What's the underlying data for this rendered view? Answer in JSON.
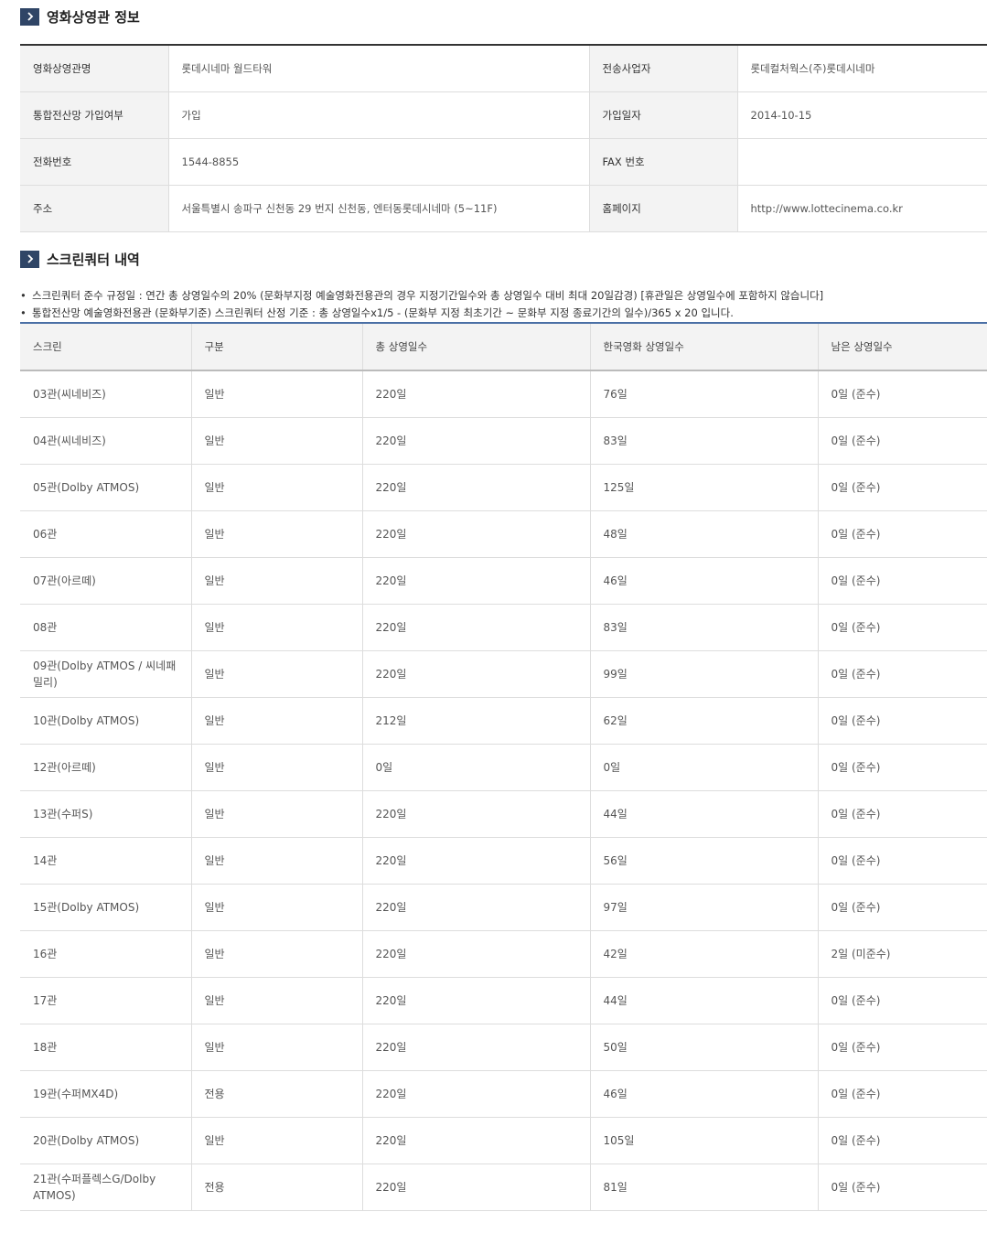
{
  "theater_section": {
    "title": "영화상영관 정보",
    "rows": [
      {
        "label1": "영화상영관명",
        "value1": "롯데시네마 월드타워",
        "label2": "전송사업자",
        "value2": "롯데컬처웍스(주)롯데시네마"
      },
      {
        "label1": "통합전산망 가입여부",
        "value1": "가입",
        "label2": "가입일자",
        "value2": "2014-10-15"
      },
      {
        "label1": "전화번호",
        "value1": "1544-8855",
        "label2": "FAX 번호",
        "value2": ""
      },
      {
        "label1": "주소",
        "value1": "서울특별시 송파구 신천동 29 번지 신천동, 엔터동롯데시네마 (5~11F)",
        "label2": "홈페이지",
        "value2": "http://www.lottecinema.co.kr"
      }
    ]
  },
  "quota_section": {
    "title": "스크린쿼터 내역",
    "notes": [
      "스크린쿼터 준수 규정일 : 연간 총 상영일수의 20% (문화부지정 예술영화전용관의 경우 지정기간일수와 총 상영일수 대비 최대 20일감경) [휴관일은 상영일수에 포함하지 않습니다]",
      "통합전산망 예술영화전용관 (문화부기준) 스크린쿼터 산정 기준 : 총 상영일수ⅹ1/5 - (문화부 지정 최초기간 ~ 문화부 지정 종료기간의 일수)/365 ⅹ 20 입니다."
    ],
    "columns": [
      "스크린",
      "구분",
      "총 상영일수",
      "한국영화 상영일수",
      "남은 상영일수"
    ],
    "rows": [
      [
        "03관(씨네비즈)",
        "일반",
        "220일",
        "76일",
        "0일 (준수)"
      ],
      [
        "04관(씨네비즈)",
        "일반",
        "220일",
        "83일",
        "0일 (준수)"
      ],
      [
        "05관(Dolby ATMOS)",
        "일반",
        "220일",
        "125일",
        "0일 (준수)"
      ],
      [
        "06관",
        "일반",
        "220일",
        "48일",
        "0일 (준수)"
      ],
      [
        "07관(아르떼)",
        "일반",
        "220일",
        "46일",
        "0일 (준수)"
      ],
      [
        "08관",
        "일반",
        "220일",
        "83일",
        "0일 (준수)"
      ],
      [
        "09관(Dolby ATMOS / 씨네패밀리)",
        "일반",
        "220일",
        "99일",
        "0일 (준수)"
      ],
      [
        "10관(Dolby ATMOS)",
        "일반",
        "212일",
        "62일",
        "0일 (준수)"
      ],
      [
        "12관(아르떼)",
        "일반",
        "0일",
        "0일",
        "0일 (준수)"
      ],
      [
        "13관(수퍼S)",
        "일반",
        "220일",
        "44일",
        "0일 (준수)"
      ],
      [
        "14관",
        "일반",
        "220일",
        "56일",
        "0일 (준수)"
      ],
      [
        "15관(Dolby ATMOS)",
        "일반",
        "220일",
        "97일",
        "0일 (준수)"
      ],
      [
        "16관",
        "일반",
        "220일",
        "42일",
        "2일 (미준수)"
      ],
      [
        "17관",
        "일반",
        "220일",
        "44일",
        "0일 (준수)"
      ],
      [
        "18관",
        "일반",
        "220일",
        "50일",
        "0일 (준수)"
      ],
      [
        "19관(수퍼MX4D)",
        "전용",
        "220일",
        "46일",
        "0일 (준수)"
      ],
      [
        "20관(Dolby ATMOS)",
        "일반",
        "220일",
        "105일",
        "0일 (준수)"
      ],
      [
        "21관(수퍼플렉스G/Dolby ATMOS)",
        "전용",
        "220일",
        "81일",
        "0일 (준수)"
      ]
    ]
  }
}
